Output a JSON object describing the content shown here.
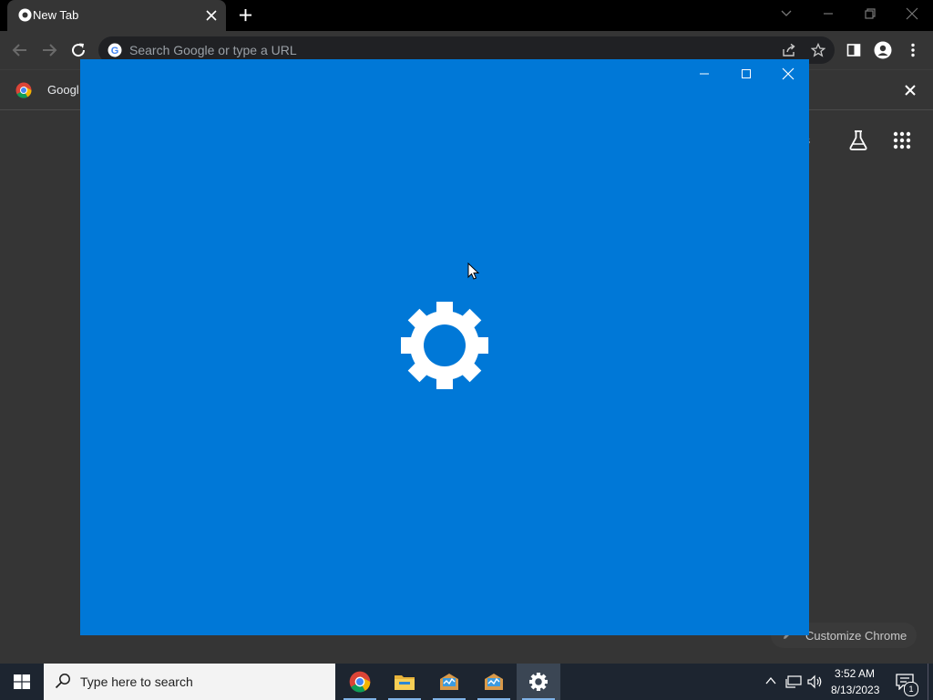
{
  "browser": {
    "tab": {
      "title": "New Tab"
    },
    "omnibox": {
      "placeholder": "Search Google or type a URL"
    },
    "infobar": {
      "text_partial": "Googl"
    },
    "ntp": {
      "images_link_partial": "ges",
      "customize_label": "Customize Chrome"
    }
  },
  "settings_window": {
    "icon": "gear-icon",
    "background_color": "#0078d7"
  },
  "taskbar": {
    "search_placeholder": "Type here to search",
    "apps": [
      "chrome-icon",
      "file-explorer-icon",
      "app-icon",
      "app-icon",
      "settings-gear-icon"
    ],
    "clock": {
      "time": "3:52 AM",
      "date": "8/13/2023"
    },
    "notification_count": "1"
  }
}
